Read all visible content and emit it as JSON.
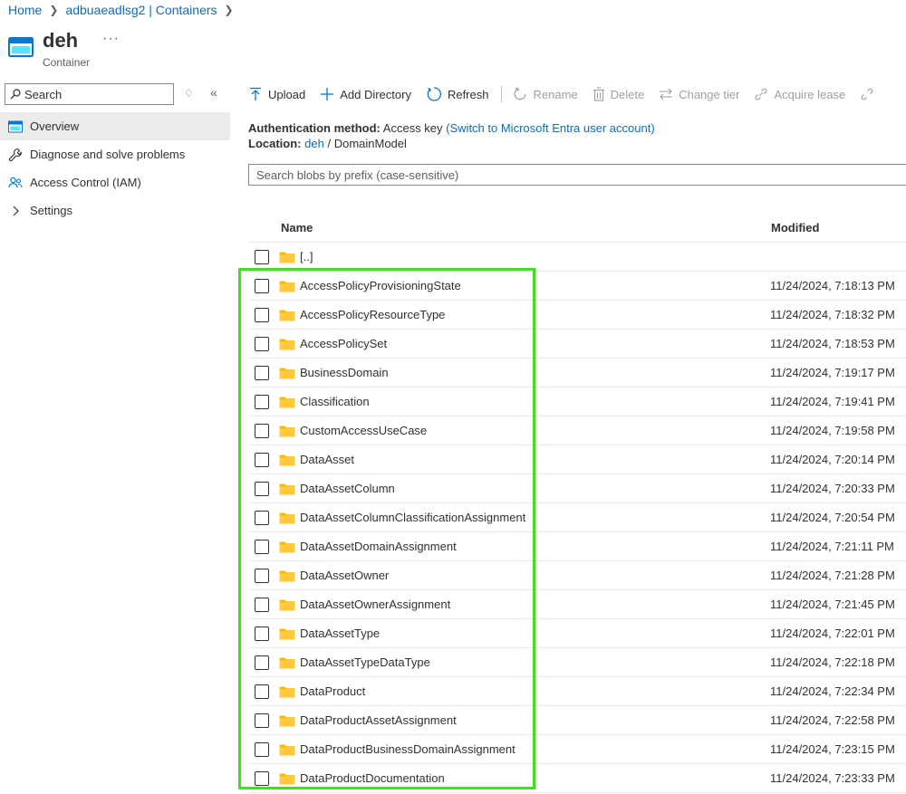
{
  "breadcrumb": {
    "home": "Home",
    "account": "adbuaeadlsg2 | Containers"
  },
  "header": {
    "title": "deh",
    "subtitle": "Container",
    "more": "···"
  },
  "sidebar": {
    "search_label": "Search",
    "items": [
      {
        "label": "Overview",
        "icon": "container-icon"
      },
      {
        "label": "Diagnose and solve problems",
        "icon": "wrench-icon"
      },
      {
        "label": "Access Control (IAM)",
        "icon": "people-icon"
      },
      {
        "label": "Settings",
        "icon": "chevron-right-icon"
      }
    ]
  },
  "toolbar": {
    "upload": "Upload",
    "add_directory": "Add Directory",
    "refresh": "Refresh",
    "rename": "Rename",
    "delete": "Delete",
    "change_tier": "Change tier",
    "acquire_lease": "Acquire lease"
  },
  "info": {
    "auth_label": "Authentication method:",
    "auth_value": "Access key",
    "auth_switch": "(Switch to Microsoft Entra user account)",
    "location_label": "Location:",
    "location_link": "deh",
    "location_sep": "/",
    "location_path": "DomainModel"
  },
  "blob_search": {
    "placeholder": "Search blobs by prefix (case-sensitive)"
  },
  "table": {
    "headers": {
      "name": "Name",
      "modified": "Modified"
    },
    "rows": [
      {
        "name": "[..]",
        "modified": ""
      },
      {
        "name": "AccessPolicyProvisioningState",
        "modified": "11/24/2024, 7:18:13 PM"
      },
      {
        "name": "AccessPolicyResourceType",
        "modified": "11/24/2024, 7:18:32 PM"
      },
      {
        "name": "AccessPolicySet",
        "modified": "11/24/2024, 7:18:53 PM"
      },
      {
        "name": "BusinessDomain",
        "modified": "11/24/2024, 7:19:17 PM"
      },
      {
        "name": "Classification",
        "modified": "11/24/2024, 7:19:41 PM"
      },
      {
        "name": "CustomAccessUseCase",
        "modified": "11/24/2024, 7:19:58 PM"
      },
      {
        "name": "DataAsset",
        "modified": "11/24/2024, 7:20:14 PM"
      },
      {
        "name": "DataAssetColumn",
        "modified": "11/24/2024, 7:20:33 PM"
      },
      {
        "name": "DataAssetColumnClassificationAssignment",
        "modified": "11/24/2024, 7:20:54 PM"
      },
      {
        "name": "DataAssetDomainAssignment",
        "modified": "11/24/2024, 7:21:11 PM"
      },
      {
        "name": "DataAssetOwner",
        "modified": "11/24/2024, 7:21:28 PM"
      },
      {
        "name": "DataAssetOwnerAssignment",
        "modified": "11/24/2024, 7:21:45 PM"
      },
      {
        "name": "DataAssetType",
        "modified": "11/24/2024, 7:22:01 PM"
      },
      {
        "name": "DataAssetTypeDataType",
        "modified": "11/24/2024, 7:22:18 PM"
      },
      {
        "name": "DataProduct",
        "modified": "11/24/2024, 7:22:34 PM"
      },
      {
        "name": "DataProductAssetAssignment",
        "modified": "11/24/2024, 7:22:58 PM"
      },
      {
        "name": "DataProductBusinessDomainAssignment",
        "modified": "11/24/2024, 7:23:15 PM"
      },
      {
        "name": "DataProductDocumentation",
        "modified": "11/24/2024, 7:23:33 PM"
      }
    ]
  },
  "colors": {
    "link": "#0f6cbd",
    "folder": "#ffb900",
    "highlight": "#44dd22",
    "active_nav": "#edebe9"
  }
}
